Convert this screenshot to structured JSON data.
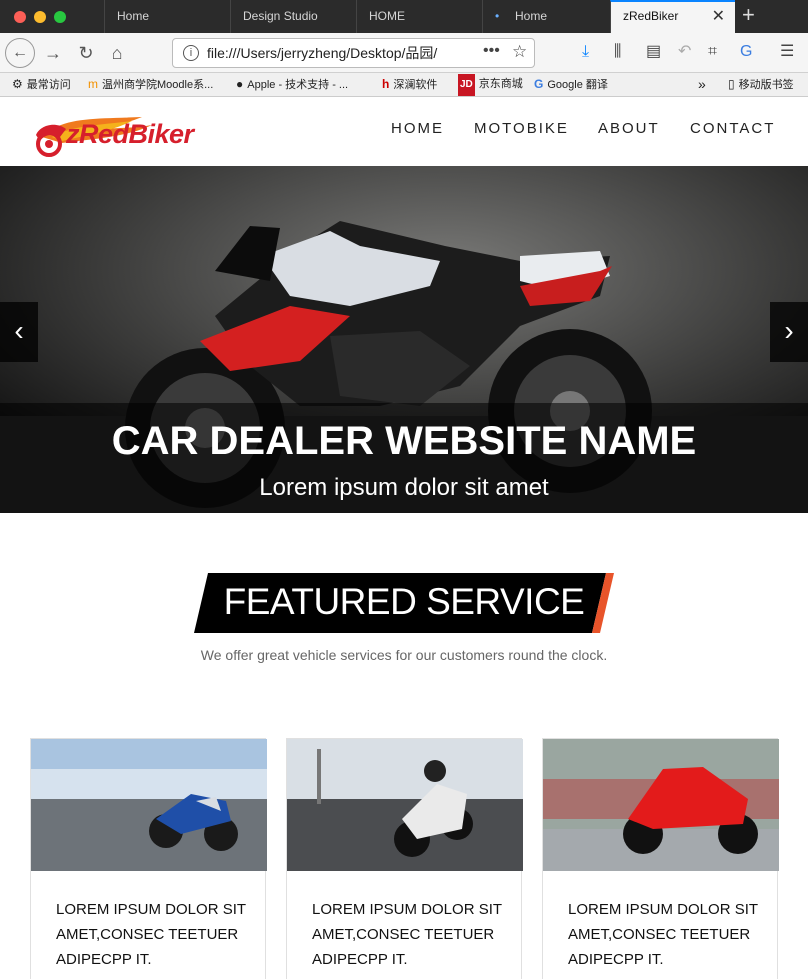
{
  "browser": {
    "tabs": [
      {
        "label": "Home"
      },
      {
        "label": "Design Studio"
      },
      {
        "label": "HOME"
      },
      {
        "label": "Home"
      },
      {
        "label": "zRedBiker"
      }
    ],
    "url": "file:///Users/jerryzheng/Desktop/品园/",
    "bookmarks": [
      {
        "label": "最常访问"
      },
      {
        "label": "温州商学院Moodle系..."
      },
      {
        "label": "Apple - 技术支持 - ..."
      },
      {
        "label": "深澜软件"
      },
      {
        "label": "京东商城"
      },
      {
        "label": "Google 翻译"
      },
      {
        "label": "移动版书签"
      }
    ]
  },
  "site": {
    "logo": "zRedBiker",
    "menu": [
      "HOME",
      "MOTOBIKE",
      "ABOUT",
      "CONTACT"
    ],
    "hero": {
      "title": "CAR DEALER WEBSITE NAME",
      "subtitle": "Lorem ipsum dolor sit amet"
    },
    "featured": {
      "title": "FEATURED SERVICE",
      "subtitle": "We offer great vehicle services for our customers round the clock."
    },
    "cards": [
      {
        "text": "LOREM IPSUM DOLOR SIT AMET,CONSEC TEETUER ADIPECPP IT."
      },
      {
        "text": "LOREM IPSUM DOLOR SIT AMET,CONSEC TEETUER ADIPECPP IT."
      },
      {
        "text": "LOREM IPSUM DOLOR SIT AMET,CONSEC TEETUER ADIPECPP IT."
      }
    ]
  },
  "colors": {
    "brand_red": "#d61f2c",
    "accent_orange": "#e8542a"
  }
}
